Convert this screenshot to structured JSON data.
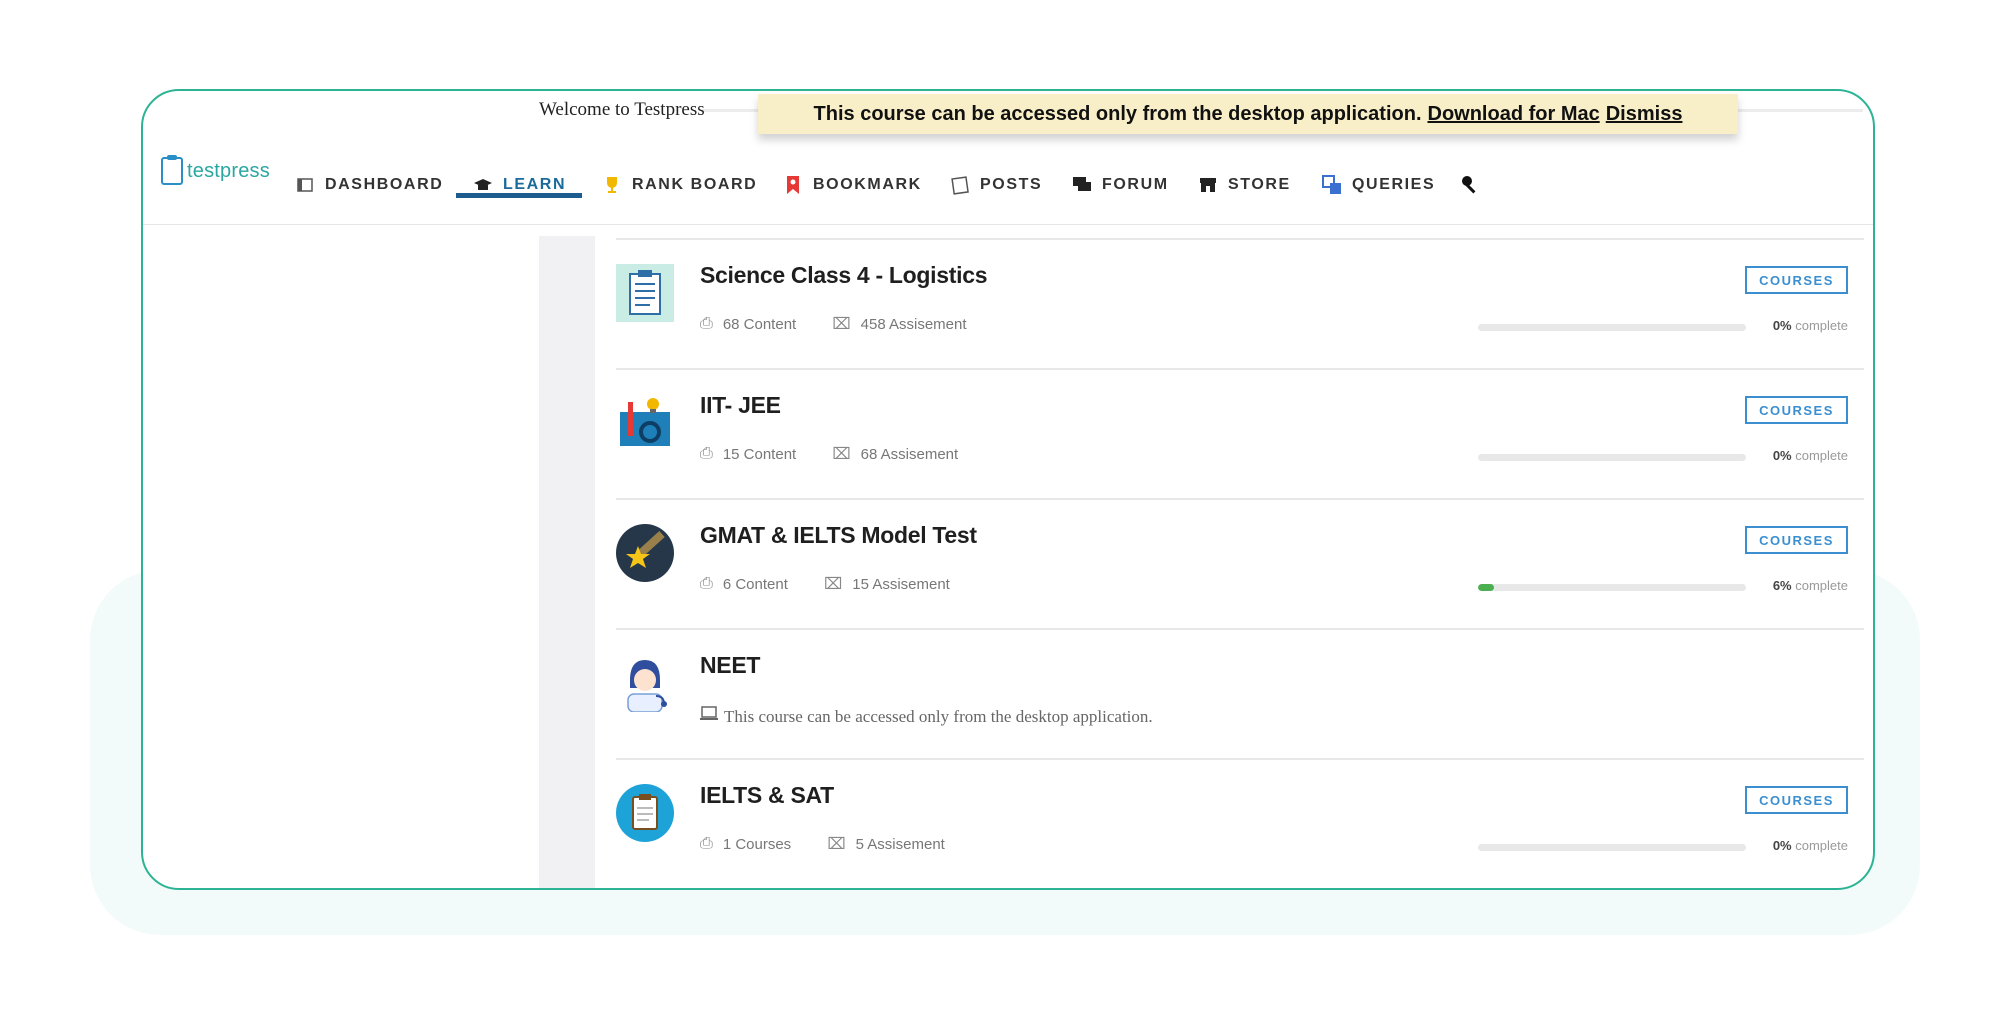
{
  "header": {
    "welcome": "Welcome to Testpress",
    "banner_text": "This course can be accessed only from the desktop application.",
    "banner_link_download": "Download for Mac",
    "banner_link_dismiss": "Dismiss"
  },
  "logo": {
    "text": "testpress"
  },
  "nav": {
    "items": [
      {
        "label": "DASHBOARD",
        "icon": "dashboard-icon"
      },
      {
        "label": "LEARN",
        "icon": "graduation-cap-icon",
        "active": true
      },
      {
        "label": "RANK BOARD",
        "icon": "trophy-icon"
      },
      {
        "label": "BOOKMARK",
        "icon": "bookmark-icon"
      },
      {
        "label": "POSTS",
        "icon": "posts-icon"
      },
      {
        "label": "FORUM",
        "icon": "forum-icon"
      },
      {
        "label": "STORE",
        "icon": "store-icon"
      },
      {
        "label": "QUERIES",
        "icon": "queries-icon"
      }
    ],
    "extra_icon": "key-icon"
  },
  "courses": [
    {
      "title": "Science Class 4 - Logistics",
      "content": "68 Content",
      "assessment": "458 Assisement",
      "badge": "COURSES",
      "progress": 0,
      "pct": "0%",
      "pct_label": "complete"
    },
    {
      "title": "IIT- JEE",
      "content": "15 Content",
      "assessment": "68 Assisement",
      "badge": "COURSES",
      "progress": 0,
      "pct": "0%",
      "pct_label": "complete"
    },
    {
      "title": "GMAT & IELTS Model Test",
      "content": "6 Content",
      "assessment": "15 Assisement",
      "badge": "COURSES",
      "progress": 6,
      "pct": "6%",
      "pct_label": "complete"
    },
    {
      "title": "NEET",
      "note": "This course can be accessed only from the desktop application."
    },
    {
      "title": "IELTS & SAT",
      "content": "1 Courses",
      "assessment": "5 Assisement",
      "badge": "COURSES",
      "progress": 0,
      "pct": "0%",
      "pct_label": "complete"
    }
  ],
  "colors": {
    "accent": "#2bb394",
    "nav_active": "#1d5c8e",
    "badge": "#3b8fd0",
    "progress_fill": "#4caf50",
    "banner_bg": "#f8efc8"
  }
}
